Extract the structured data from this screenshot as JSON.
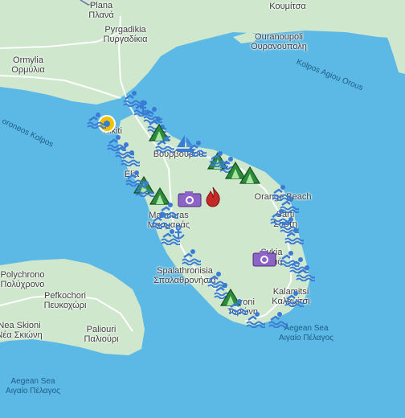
{
  "map": {
    "colors": {
      "sea": "#5cb8e4",
      "land": "#cfe8cd",
      "land_dark": "#bfe2bd",
      "road": "#ffffff",
      "beach_icon": "#3a7bd5",
      "camp_icon": "#2e8b3a",
      "volcano_icon": "#c62828",
      "camera_icon": "#8e63c7"
    },
    "labels": {
      "plana": "Plana\nΠλανά",
      "kουmitsa": "Κουμίτσα",
      "pyrgadikia": "Pyrgadikia\nΠυργαδίκια",
      "ormylia": "Ormylia\nΟρμύλια",
      "ouranoupoli": "Ouranoupoli\nΟυρανούπολη",
      "kolpos_agiou_orous": "Kolpos Agiou Orous",
      "toroneos_kolpos": "oroneos Kolpos",
      "nikiti": "Nikiti",
      "vourvourou": "Βουρβουρού",
      "elia": "Elia",
      "oranoupoli_beach": "Orange Beach",
      "marmaras": "Marmaras\nΜαρμαράς",
      "sarti": "Sarti\nΣάρτη",
      "sykia": "Sykia\nΣυκιά",
      "polychrono": "Polychrono\nΠολύχρονο",
      "pefkochori": "Pefkochori\nΠευκοχώρι",
      "spalathronisia": "Spalathronisia\nΣπαλαθρονήσια",
      "toroni": "Toroni\nΤορώνη",
      "kalamitsi": "Kalamitsi\nΚαλαμίτσι",
      "nea_skioni": "Nea Skioni\nΝέα Σκιώνη",
      "paliouri": "Paliouri\nΠαλιούρι",
      "aegean_sea_1": "Aegean Sea\nΑιγαίο Πέλαγος",
      "aegean_sea_2": "Aegean Sea\nΑιγαίο Πέλαγος"
    },
    "markers": [
      {
        "type": "beach",
        "name": "beach-marker"
      },
      {
        "type": "camp",
        "name": "camping-marker"
      },
      {
        "type": "anchor",
        "name": "anchor-marker"
      },
      {
        "type": "sailboat",
        "name": "sailboat-marker"
      },
      {
        "type": "camera",
        "name": "camera-marker"
      },
      {
        "type": "volcano",
        "name": "fire-marker"
      }
    ]
  }
}
